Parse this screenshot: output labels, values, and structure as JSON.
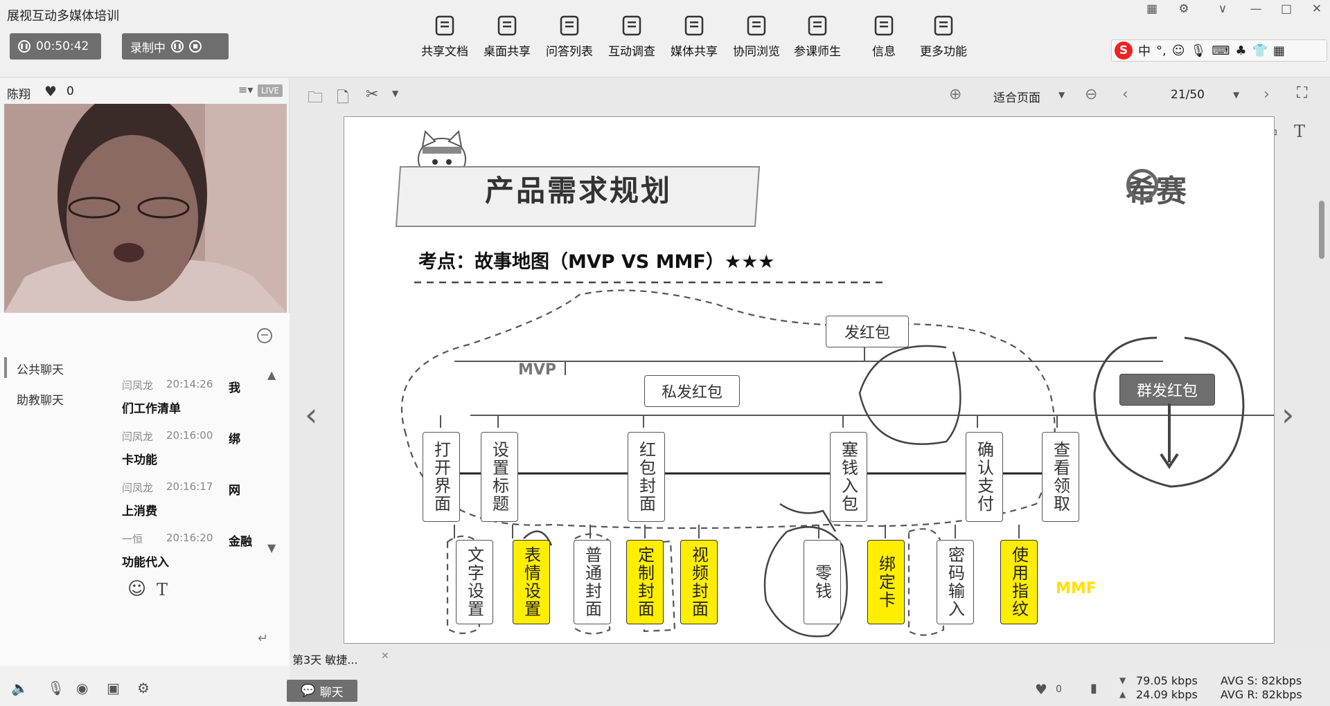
{
  "app": {
    "title": "展视互动多媒体培训"
  },
  "timer": {
    "time": "00:50:42",
    "recording_label": "录制中"
  },
  "toolbar": {
    "items": [
      {
        "label": "共享文档",
        "icon": "document-icon"
      },
      {
        "label": "桌面共享",
        "icon": "desktop-share-icon"
      },
      {
        "label": "问答列表",
        "icon": "qa-icon"
      },
      {
        "label": "互动调查",
        "icon": "survey-icon"
      },
      {
        "label": "媒体共享",
        "icon": "media-icon"
      },
      {
        "label": "协同浏览",
        "icon": "compass-icon"
      },
      {
        "label": "参课师生",
        "icon": "users-icon"
      },
      {
        "label": "信息",
        "icon": "info-icon"
      },
      {
        "label": "更多功能",
        "icon": "more-icon"
      }
    ]
  },
  "ime": {
    "lang": "中"
  },
  "presenter": {
    "name": "陈翔",
    "likes": "0",
    "live": "LIVE"
  },
  "chat": {
    "tabs": [
      "公共聊天",
      "助教聊天"
    ],
    "messages": [
      {
        "name": "闫凤龙",
        "time": "20:14:26",
        "text_a": "我",
        "text_b": "们工作清单"
      },
      {
        "name": "闫凤龙",
        "time": "20:16:00",
        "text_a": "绑",
        "text_b": "卡功能"
      },
      {
        "name": "闫凤龙",
        "time": "20:16:17",
        "text_a": "网",
        "text_b": "上消费"
      },
      {
        "name": "一恒",
        "time": "20:16:20",
        "text_a": "金融",
        "text_b": "功能代入"
      }
    ]
  },
  "doc_tab": {
    "label": "第3天 敏捷..."
  },
  "chat_button": {
    "label": "聊天"
  },
  "viewer": {
    "zoom": "适合页面",
    "page": "21/50"
  },
  "slide": {
    "title": "产品需求规划",
    "brand": "希赛",
    "subtitle": "考点：故事地图（MVP VS MMF）★★★",
    "mvp": "MVP",
    "mmf": "MMF",
    "root": "发红包",
    "private": "私发红包",
    "group": "群发红包",
    "steps": [
      "打开界面",
      "设置标题",
      "红包封面",
      "塞钱入包",
      "确认支付",
      "查看领取"
    ],
    "subs": [
      {
        "label": "文字设置",
        "yellow": false
      },
      {
        "label": "表情设置",
        "yellow": true
      },
      {
        "label": "普通封面",
        "yellow": false
      },
      {
        "label": "定制封面",
        "yellow": true
      },
      {
        "label": "视频封面",
        "yellow": true
      },
      {
        "label": "零钱",
        "yellow": false
      },
      {
        "label": "绑定卡",
        "yellow": true
      },
      {
        "label": "密码输入",
        "yellow": false
      },
      {
        "label": "使用指纹",
        "yellow": true
      }
    ]
  },
  "status": {
    "likes": "0",
    "down": "79.05 kbps",
    "up": "24.09 kbps",
    "avg_s": "AVG S: 82kbps",
    "avg_r": "AVG R: 82kbps"
  }
}
